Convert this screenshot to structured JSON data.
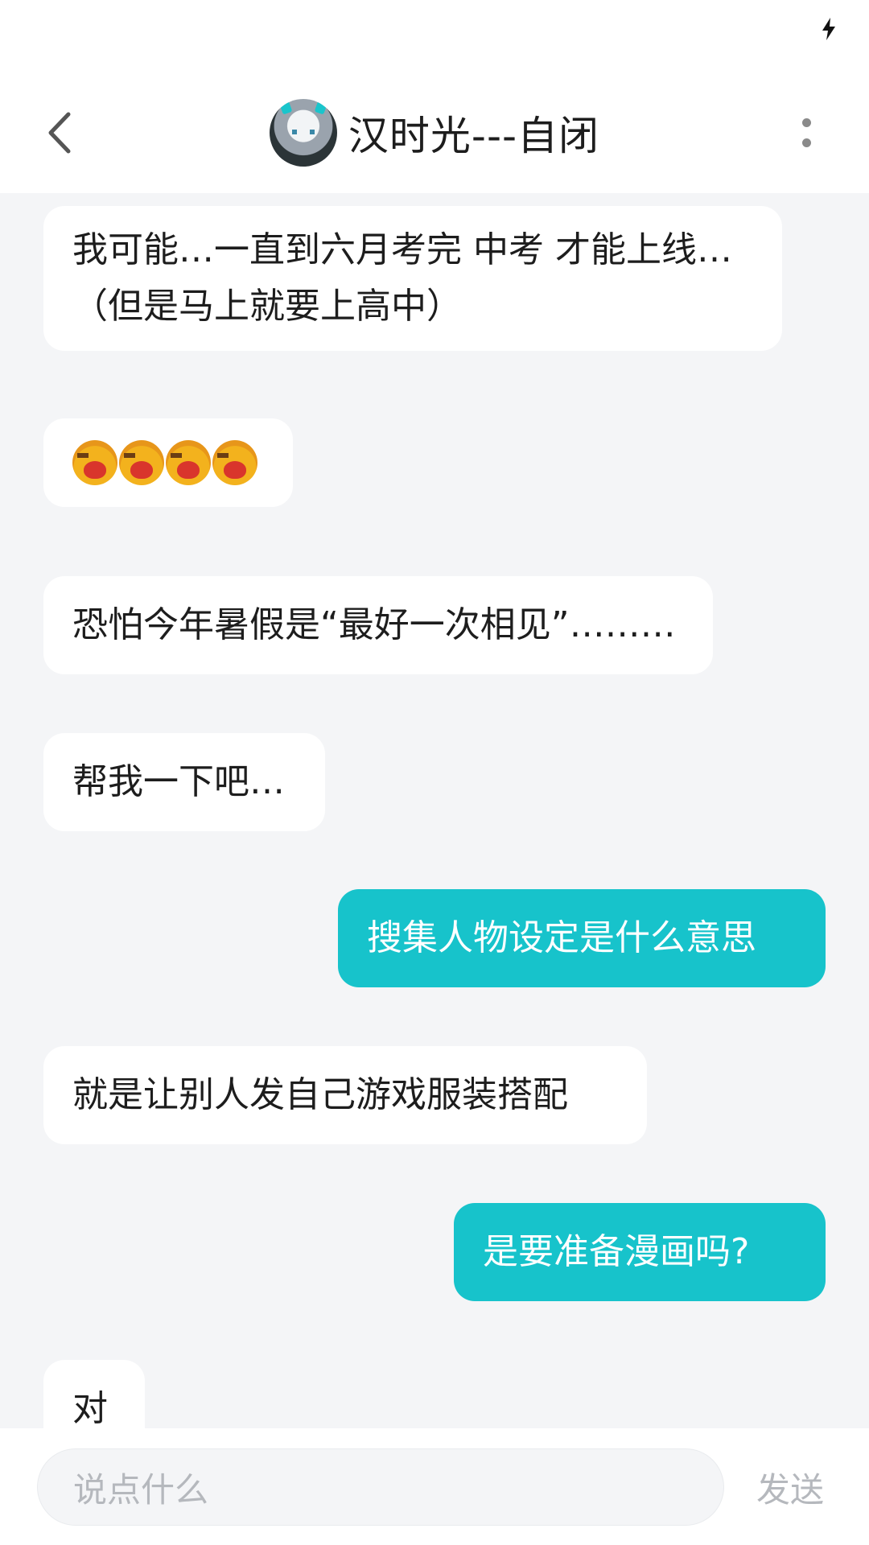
{
  "header": {
    "title": "汉时光---自闭"
  },
  "messages": [
    {
      "side": "in",
      "text": "我可能…一直到六月考完 中考 才能上线…（但是马上就要上高中）"
    },
    {
      "side": "in",
      "type": "emoji",
      "emojis": [
        "loudly-crying-emoji",
        "loudly-crying-emoji",
        "loudly-crying-emoji",
        "loudly-crying-emoji"
      ]
    },
    {
      "side": "in",
      "text": "恐怕今年暑假是“最好一次相见”………"
    },
    {
      "side": "in",
      "text": "帮我一下吧…"
    },
    {
      "side": "out",
      "text": "搜集人物设定是什么意思"
    },
    {
      "side": "in",
      "text": "就是让别人发自己游戏服装搭配"
    },
    {
      "side": "out",
      "text": "是要准备漫画吗?"
    },
    {
      "side": "in",
      "text": "对"
    }
  ],
  "input": {
    "placeholder": "说点什么",
    "send_label": "发送"
  },
  "colors": {
    "outgoing_bubble": "#17c3cb",
    "incoming_bubble": "#ffffff",
    "background": "#f4f5f7"
  }
}
